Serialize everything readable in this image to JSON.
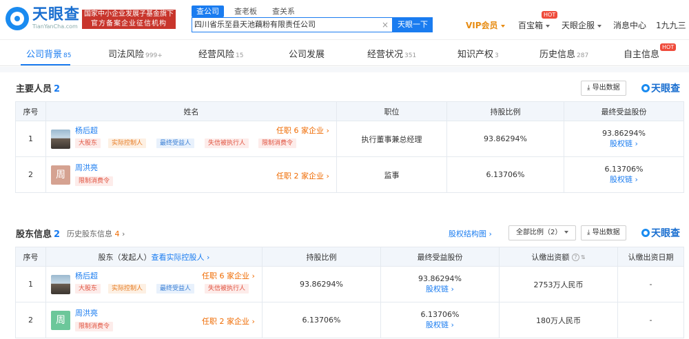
{
  "header": {
    "logo_cn": "天眼查",
    "logo_en": "TianYanCha.com",
    "gov_line1": "国家中小企业发展子基金旗下",
    "gov_line2": "官方备案企业征信机构",
    "search_tabs": [
      "查公司",
      "查老板",
      "查关系"
    ],
    "search_value": "四川省乐至县天池藕粉有限责任公司",
    "search_button": "天眼一下",
    "vip": "VIP会员",
    "baibaoxiang": "百宝箱",
    "qiye": "天眼企服",
    "msg": "消息中心",
    "user": "1九九三",
    "hot": "HOT"
  },
  "tabs": [
    {
      "label": "公司背景",
      "count": "85"
    },
    {
      "label": "司法风险",
      "count": "999+"
    },
    {
      "label": "经营风险",
      "count": "15"
    },
    {
      "label": "公司发展",
      "count": ""
    },
    {
      "label": "经营状况",
      "count": "351"
    },
    {
      "label": "知识产权",
      "count": "3"
    },
    {
      "label": "历史信息",
      "count": "287"
    },
    {
      "label": "自主信息",
      "count": ""
    }
  ],
  "staff": {
    "title": "主要人员",
    "count": "2",
    "export": "导出数据",
    "brand": "天眼查",
    "headers": [
      "序号",
      "姓名",
      "职位",
      "持股比例",
      "最终受益股份"
    ],
    "rows": [
      {
        "no": "1",
        "name": "杨后超",
        "renzhi": "任职 6 家企业",
        "tags": [
          "大股东",
          "实际控制人",
          "最终受益人",
          "失信被执行人",
          "限制消费令"
        ],
        "position": "执行董事兼总经理",
        "ratio": "93.86294%",
        "benefit": "93.86294%",
        "chain": "股权链"
      },
      {
        "no": "2",
        "name": "周洪亮",
        "avatar": "周",
        "renzhi": "任职 2 家企业",
        "tags": [
          "限制消费令"
        ],
        "position": "监事",
        "ratio": "6.13706%",
        "benefit": "6.13706%",
        "chain": "股权链"
      }
    ]
  },
  "holders": {
    "title": "股东信息",
    "count": "2",
    "history": "历史股东信息",
    "history_count": "4",
    "structure": "股权结构图",
    "select": "全部比例（2）",
    "export": "导出数据",
    "brand": "天眼查",
    "headers": [
      "序号",
      "股东（发起人）",
      "查看实际控股人",
      "持股比例",
      "最终受益股份",
      "认缴出资额",
      "认缴出资日期"
    ],
    "rows": [
      {
        "no": "1",
        "name": "杨后超",
        "renzhi": "任职 6 家企业",
        "tags": [
          "大股东",
          "实际控制人",
          "最终受益人",
          "失信被执行人"
        ],
        "ratio": "93.86294%",
        "benefit": "93.86294%",
        "chain": "股权链",
        "amount": "2753万人民币",
        "date": "-"
      },
      {
        "no": "2",
        "name": "周洪亮",
        "avatar": "周",
        "renzhi": "任职 2 家企业",
        "tags": [
          "限制消费令"
        ],
        "ratio": "6.13706%",
        "benefit": "6.13706%",
        "chain": "股权链",
        "amount": "180万人民币",
        "date": "-"
      }
    ]
  }
}
